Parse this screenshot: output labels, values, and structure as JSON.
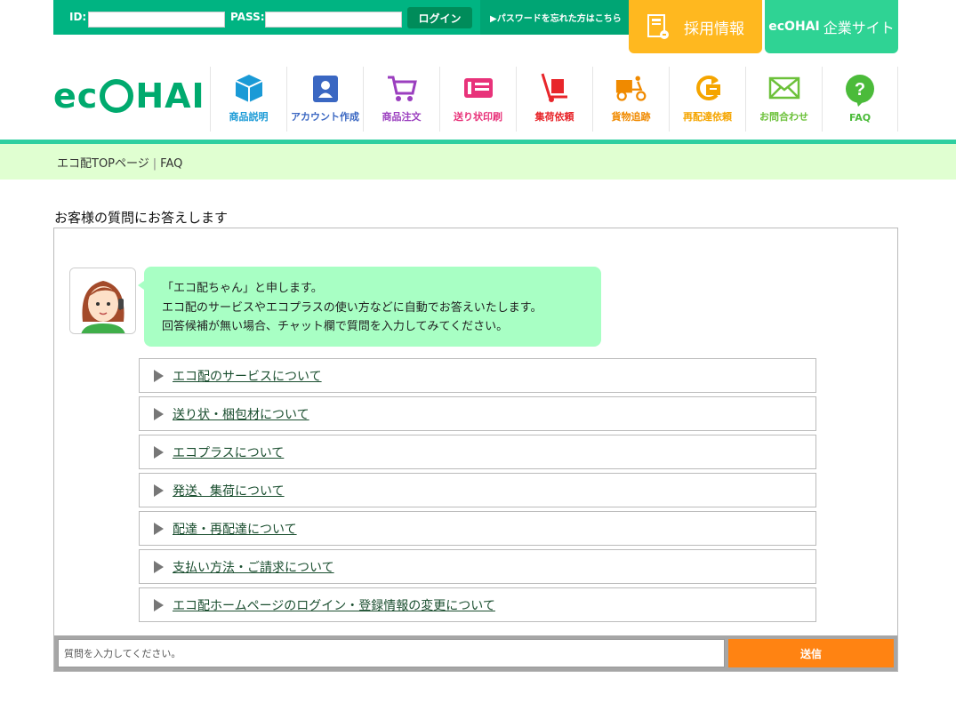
{
  "login": {
    "id_label": "ID:",
    "pass_label": "PASS:",
    "login_button": "ログイン",
    "forgot_link": "▶パスワードを忘れた方はこちら"
  },
  "header_links": {
    "recruit": "採用情報",
    "corporate_logo": "ecOHAI",
    "corporate": "企業サイト"
  },
  "logo": {
    "left": "ec",
    "right": "HAI"
  },
  "nav": [
    {
      "label": "商品説明",
      "icon": "box-icon",
      "color": "#1a9ad6"
    },
    {
      "label": "アカウント作成",
      "icon": "id-card-icon",
      "color": "#3a67c2"
    },
    {
      "label": "商品注文",
      "icon": "cart-icon",
      "color": "#9b3fbf"
    },
    {
      "label": "送り状印刷",
      "icon": "ticket-icon",
      "color": "#e8337a"
    },
    {
      "label": "集荷依頼",
      "icon": "hand-truck-icon",
      "color": "#e8262b"
    },
    {
      "label": "貨物追跡",
      "icon": "delivery-bike-icon",
      "color": "#f08a00"
    },
    {
      "label": "再配達依頼",
      "icon": "redelivery-icon",
      "color": "#f5a500"
    },
    {
      "label": "お問合わせ",
      "icon": "mail-icon",
      "color": "#6cc13a"
    },
    {
      "label": "FAQ",
      "icon": "question-icon",
      "color": "#4bbb3a"
    }
  ],
  "breadcrumb": {
    "home": "エコ配TOPページ",
    "separator": "|",
    "current": "FAQ"
  },
  "section_title": "お客様の質問にお答えします",
  "bot_message": [
    "「エコ配ちゃん」と申します。",
    "エコ配のサービスやエコプラスの使い方などに自動でお答えいたします。",
    "回答候補が無い場合、チャット欄で質問を入力してみてください。"
  ],
  "faq_items": [
    "エコ配のサービスについて",
    "送り状・梱包材について",
    "エコプラスについて",
    "発送、集荷について",
    "配達・再配達について",
    "支払い方法・ご請求について",
    "エコ配ホームページのログイン・登録情報の変更について"
  ],
  "chat": {
    "placeholder": "質問を入力してください。",
    "send_button": "送信"
  },
  "colors": {
    "brand_green": "#00b482",
    "bubble": "#a8ffc4",
    "crumb_bg": "#e0ffd1",
    "send": "#ff8312",
    "recruit": "#ffb81f"
  }
}
